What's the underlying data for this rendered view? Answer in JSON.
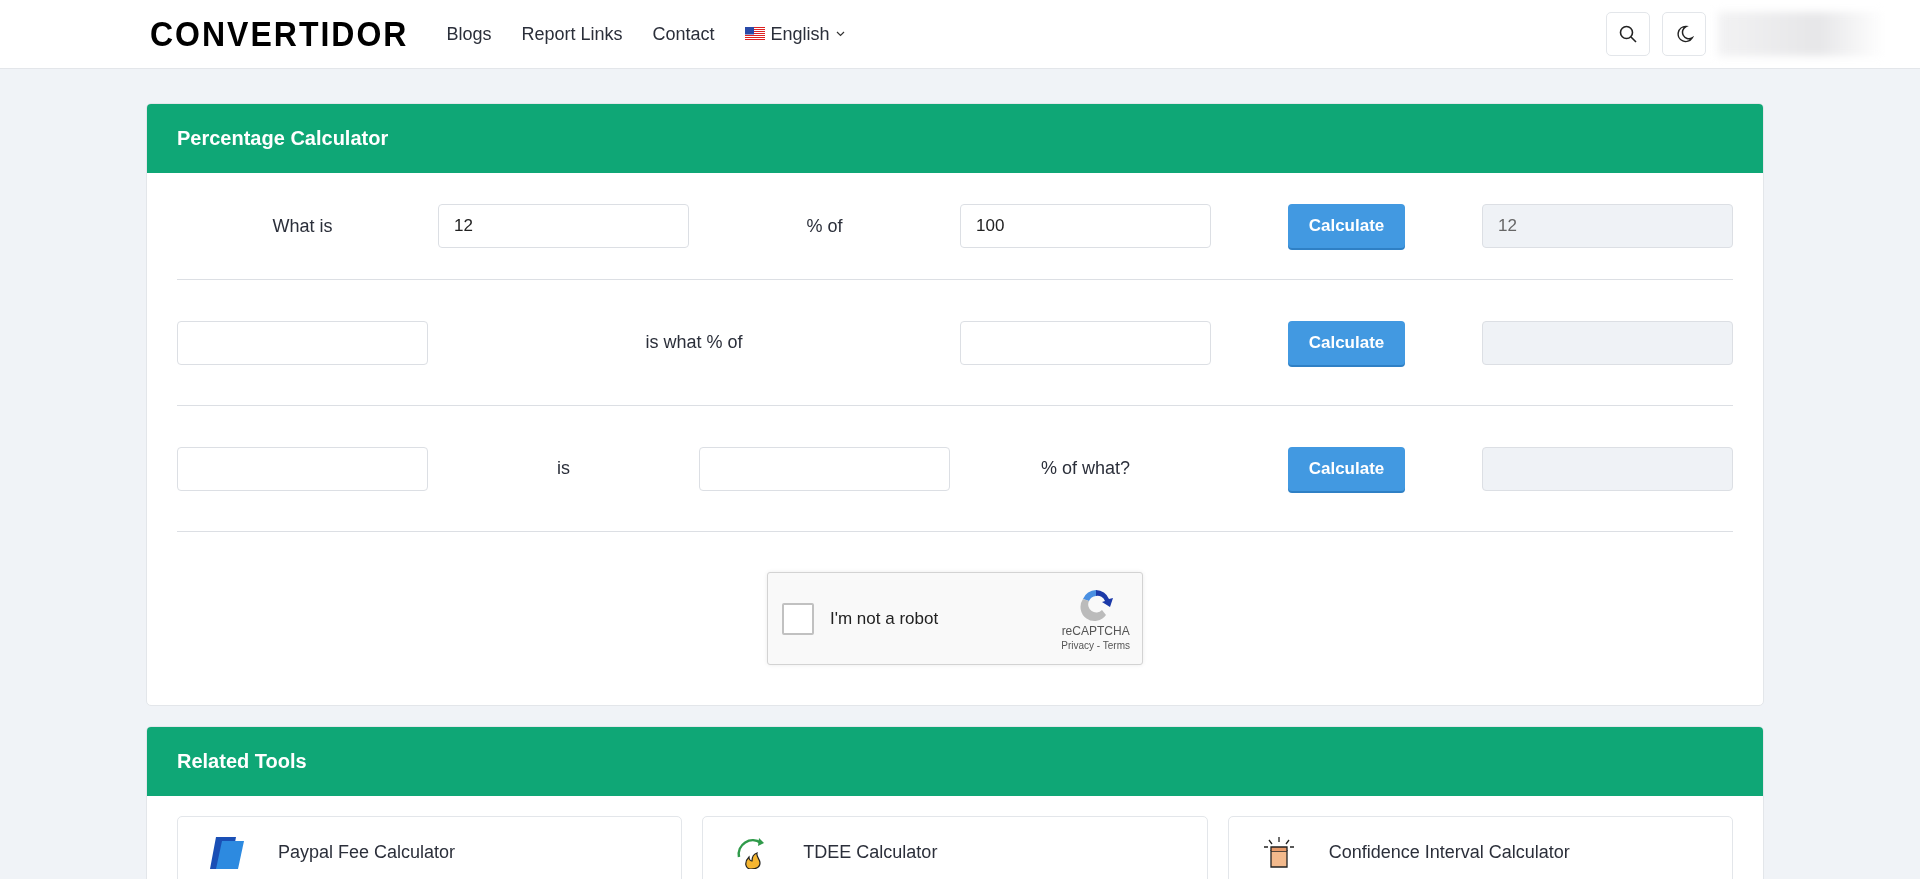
{
  "header": {
    "logo": "CONVERTIDOR",
    "nav": [
      {
        "label": "Blogs"
      },
      {
        "label": "Report Links"
      },
      {
        "label": "Contact"
      }
    ],
    "language": "English"
  },
  "calculator": {
    "title": "Percentage Calculator",
    "rows": [
      {
        "items": [
          {
            "kind": "text",
            "text": "What is"
          },
          {
            "kind": "input",
            "value": "12"
          },
          {
            "kind": "text",
            "text": "% of"
          },
          {
            "kind": "input",
            "value": "100"
          },
          {
            "kind": "button",
            "text": "Calculate"
          },
          {
            "kind": "result",
            "value": "12"
          }
        ]
      },
      {
        "items": [
          {
            "kind": "input"
          },
          {
            "kind": "wide-text",
            "text": "is what % of"
          },
          {
            "kind": "input"
          },
          {
            "kind": "button",
            "text": "Calculate"
          },
          {
            "kind": "result"
          }
        ]
      },
      {
        "items": [
          {
            "kind": "input"
          },
          {
            "kind": "text",
            "text": "is"
          },
          {
            "kind": "input"
          },
          {
            "kind": "text",
            "text": "% of what?"
          },
          {
            "kind": "button",
            "text": "Calculate"
          },
          {
            "kind": "result"
          }
        ]
      }
    ],
    "captcha": {
      "label": "I'm not a robot",
      "checked": false,
      "brand": "reCAPTCHA",
      "links": "Privacy - Terms"
    }
  },
  "related": {
    "title": "Related Tools",
    "tools": [
      {
        "name": "Paypal Fee Calculator"
      },
      {
        "name": "TDEE Calculator"
      },
      {
        "name": "Confidence Interval Calculator"
      }
    ]
  }
}
